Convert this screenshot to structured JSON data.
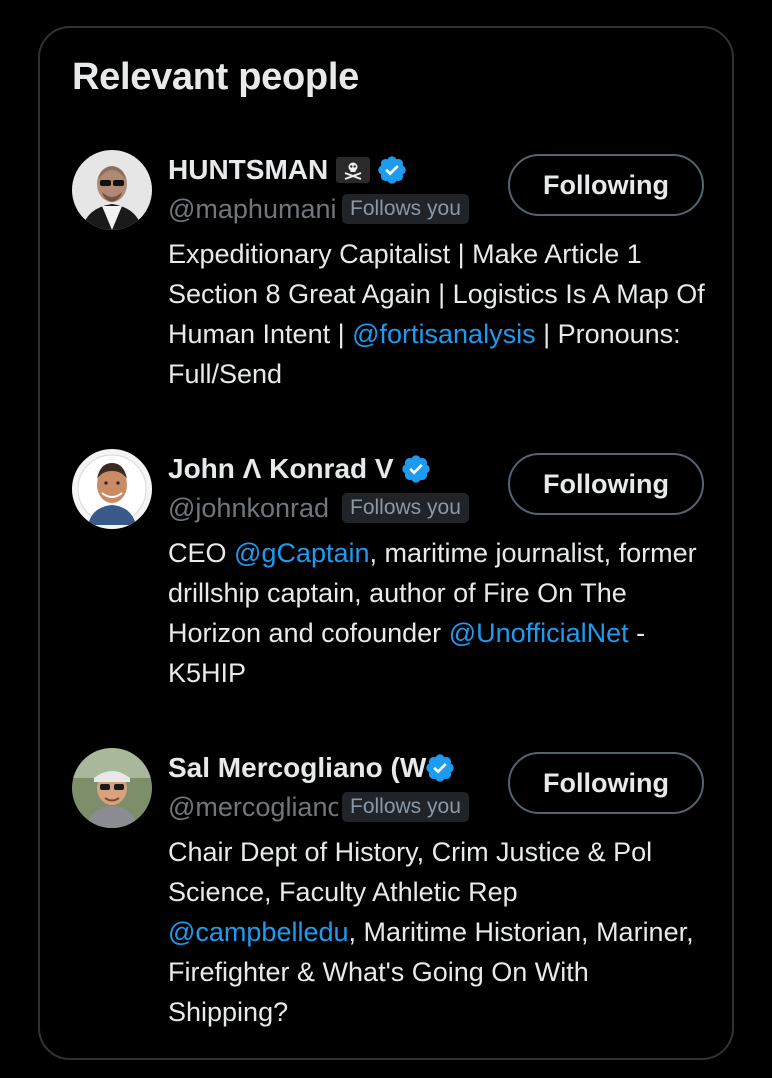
{
  "title": "Relevant people",
  "colors": {
    "background": "#000000",
    "accent": "#1d9bf0",
    "text": "#e7e9ea",
    "muted": "#71767b",
    "border": "#2f3336"
  },
  "people": [
    {
      "name": "HUNTSMAN",
      "handle": "@maphumanintent",
      "flag_icon": "pirate-flag-icon",
      "follows_you": "Follows you",
      "button_label": "Following",
      "bio": [
        {
          "text": "Expeditionary Capitalist | Make Article 1 Section 8 Great Again | Logistics Is A Map Of Human Intent | "
        },
        {
          "mention": "@fortisanalysis"
        },
        {
          "text": " | Pronouns: Full/Send"
        }
      ]
    },
    {
      "name": "John Λ Konrad V",
      "handle": "@johnkonrad",
      "follows_you": "Follows you",
      "button_label": "Following",
      "bio": [
        {
          "text": "CEO "
        },
        {
          "mention": "@gCaptain"
        },
        {
          "text": ", maritime journalist, former drillship captain, author of Fire On The Horizon and cofounder "
        },
        {
          "mention": "@UnofficialNet"
        },
        {
          "text": " - K5HIP"
        }
      ]
    },
    {
      "name": "Sal Mercogliano (W",
      "handle": "@mercogliano",
      "follows_you": "Follows you",
      "button_label": "Following",
      "bio": [
        {
          "text": "Chair Dept of History, Crim Justice & Pol Science, Faculty Athletic Rep "
        },
        {
          "mention": "@campbelledu"
        },
        {
          "text": ", Maritime Historian, Mariner, Firefighter & What's Going On With Shipping?"
        }
      ]
    }
  ]
}
